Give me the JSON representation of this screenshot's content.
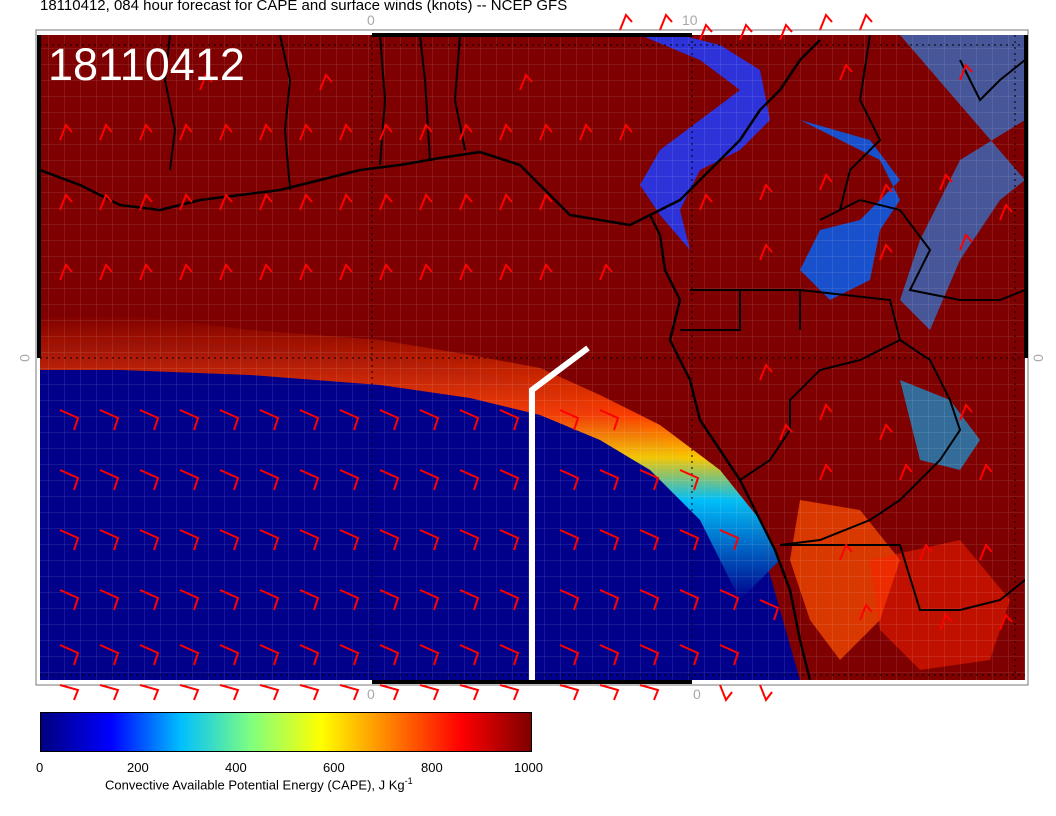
{
  "title": "18110412, 084 hour forecast for CAPE and surface winds (knots) -- NCEP GFS",
  "stamp": "18110412",
  "axis_ticks": {
    "top": [
      "0",
      "10"
    ],
    "bottom": [
      "0",
      "0"
    ],
    "left": "0",
    "right": "0"
  },
  "colorbar": {
    "ticks": [
      "0",
      "200",
      "400",
      "600",
      "800",
      "1000"
    ],
    "title_main": "Convective Available Potential Energy (CAPE), J Kg",
    "title_sup": "-1",
    "colors": [
      "#00007f",
      "#0000ff",
      "#00bfff",
      "#7fff7f",
      "#ffff00",
      "#ff7f00",
      "#ff0000",
      "#7f0000"
    ]
  },
  "colors": {
    "high_cape": "#7f0000",
    "low_cape": "#00008b",
    "wind_barb": "#ff0000",
    "coastline": "#000000",
    "section_line": "#ffffff"
  }
}
